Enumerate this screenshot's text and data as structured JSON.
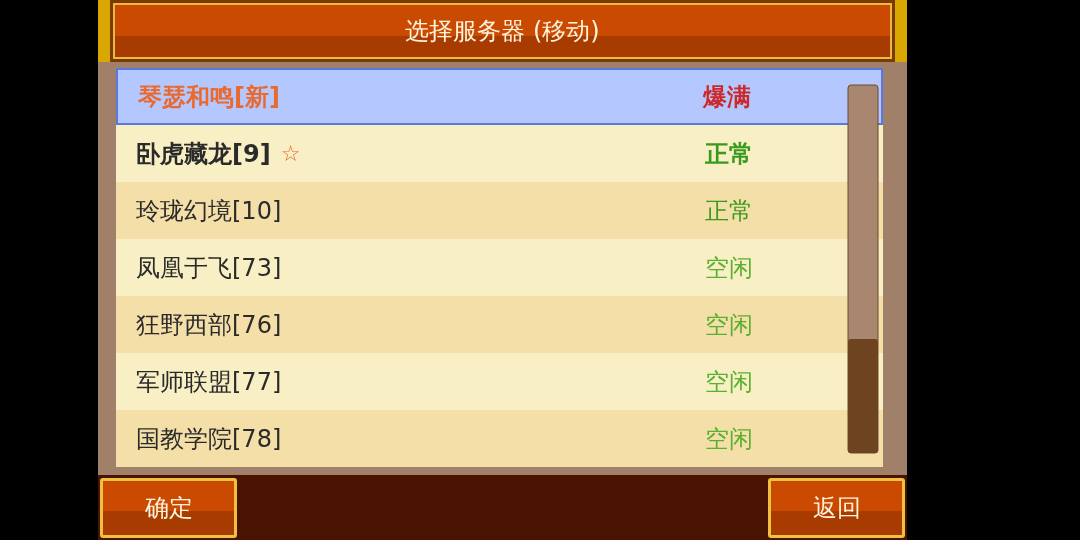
{
  "title": "选择服务器 (移动)",
  "servers": [
    {
      "name": "琴瑟和鸣[新]",
      "status": "爆满",
      "color": "#cc2a2a",
      "selected": true,
      "emphasized": true
    },
    {
      "name": "卧虎藏龙[9]",
      "mark": "☆",
      "status": "正常",
      "color": "#3a9a1e",
      "selected": false,
      "emphasized": true
    },
    {
      "name": "玲珑幻境[10]",
      "status": "正常",
      "color": "#3a9a1e",
      "selected": false,
      "emphasized": false
    },
    {
      "name": "凤凰于飞[73]",
      "status": "空闲",
      "color": "#5ab030",
      "selected": false,
      "emphasized": false
    },
    {
      "name": "狂野西部[76]",
      "status": "空闲",
      "color": "#5ab030",
      "selected": false,
      "emphasized": false
    },
    {
      "name": "军师联盟[77]",
      "status": "空闲",
      "color": "#5ab030",
      "selected": false,
      "emphasized": false
    },
    {
      "name": "国教学院[78]",
      "status": "空闲",
      "color": "#5ab030",
      "selected": false,
      "emphasized": false
    }
  ],
  "buttons": {
    "confirm": "确定",
    "back": "返回"
  }
}
